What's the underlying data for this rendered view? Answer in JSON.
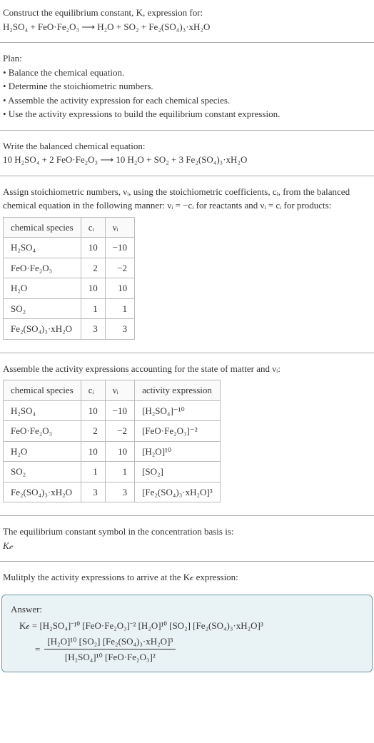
{
  "intro": {
    "line1": "Construct the equilibrium constant, K, expression for:",
    "equation": "H₂SO₄ + FeO·Fe₂O₃  ⟶  H₂O + SO₂ + Fe₂(SO₄)₃·xH₂O"
  },
  "plan": {
    "heading": "Plan:",
    "b1": "• Balance the chemical equation.",
    "b2": "• Determine the stoichiometric numbers.",
    "b3": "• Assemble the activity expression for each chemical species.",
    "b4": "• Use the activity expressions to build the equilibrium constant expression."
  },
  "balanced": {
    "heading": "Write the balanced chemical equation:",
    "equation": "10 H₂SO₄ + 2 FeO·Fe₂O₃  ⟶  10 H₂O + SO₂ + 3 Fe₂(SO₄)₃·xH₂O"
  },
  "assign": {
    "text": "Assign stoichiometric numbers, νᵢ, using the stoichiometric coefficients, cᵢ, from the balanced chemical equation in the following manner: νᵢ = −cᵢ for reactants and νᵢ = cᵢ for products:"
  },
  "table1": {
    "h1": "chemical species",
    "h2": "cᵢ",
    "h3": "νᵢ",
    "r1c1": "H₂SO₄",
    "r1c2": "10",
    "r1c3": "−10",
    "r2c1": "FeO·Fe₂O₃",
    "r2c2": "2",
    "r2c3": "−2",
    "r3c1": "H₂O",
    "r3c2": "10",
    "r3c3": "10",
    "r4c1": "SO₂",
    "r4c2": "1",
    "r4c3": "1",
    "r5c1": "Fe₂(SO₄)₃·xH₂O",
    "r5c2": "3",
    "r5c3": "3"
  },
  "assemble": {
    "text": "Assemble the activity expressions accounting for the state of matter and νᵢ:"
  },
  "table2": {
    "h1": "chemical species",
    "h2": "cᵢ",
    "h3": "νᵢ",
    "h4": "activity expression",
    "r1c1": "H₂SO₄",
    "r1c2": "10",
    "r1c3": "−10",
    "r1c4": "[H₂SO₄]⁻¹⁰",
    "r2c1": "FeO·Fe₂O₃",
    "r2c2": "2",
    "r2c3": "−2",
    "r2c4": "[FeO·Fe₂O₃]⁻²",
    "r3c1": "H₂O",
    "r3c2": "10",
    "r3c3": "10",
    "r3c4": "[H₂O]¹⁰",
    "r4c1": "SO₂",
    "r4c2": "1",
    "r4c3": "1",
    "r4c4": "[SO₂]",
    "r5c1": "Fe₂(SO₄)₃·xH₂O",
    "r5c2": "3",
    "r5c3": "3",
    "r5c4": "[Fe₂(SO₄)₃·xH₂O]³"
  },
  "symbol": {
    "line1": "The equilibrium constant symbol in the concentration basis is:",
    "line2": "K𝒸"
  },
  "multiply": {
    "text": "Mulitply the activity expressions to arrive at the K𝒸 expression:"
  },
  "answer": {
    "heading": "Answer:",
    "line1": "K𝒸 = [H₂SO₄]⁻¹⁰ [FeO·Fe₂O₃]⁻² [H₂O]¹⁰ [SO₂] [Fe₂(SO₄)₃·xH₂O]³",
    "numerator": "[H₂O]¹⁰ [SO₂] [Fe₂(SO₄)₃·xH₂O]³",
    "denominator": "[H₂SO₄]¹⁰ [FeO·Fe₂O₃]²"
  }
}
